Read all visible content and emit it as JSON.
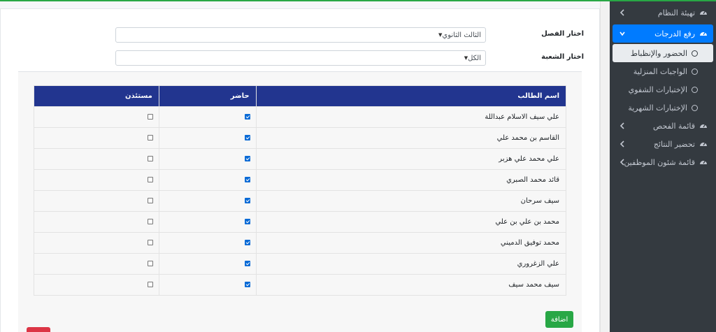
{
  "sidebar": {
    "items": [
      {
        "label": "تهيئة النظام",
        "icon": "gauge-icon",
        "chevron": "left"
      },
      {
        "label": "رفع الدرجات",
        "icon": "gauge-icon",
        "chevron": "down",
        "active": true
      },
      {
        "label": "قائمة الفحص",
        "icon": "gauge-icon",
        "chevron": "left"
      },
      {
        "label": "تحضير النتائج",
        "icon": "gauge-icon",
        "chevron": "left"
      },
      {
        "label": "قائمة شئون الموظفين",
        "icon": "gauge-icon",
        "chevron": "left"
      }
    ],
    "subitems": [
      {
        "label": "الحضور والإنظباط",
        "active": true
      },
      {
        "label": "الواجبات المنزلية"
      },
      {
        "label": "الإختبارات الشفوي"
      },
      {
        "label": "الإختبارات الشهرية"
      }
    ]
  },
  "form": {
    "class_label": "اختار الفصل",
    "class_value": "الثالث الثانوي",
    "section_label": "اختار الشعبة",
    "section_value": "الكل"
  },
  "table": {
    "headers": {
      "name": "اسم الطالب",
      "present": "حاضر",
      "excused": "مستئذن"
    },
    "rows": [
      {
        "name": "علي سيف الاسلام عبداللة",
        "present": true,
        "excused": false
      },
      {
        "name": "القاسم بن محمد علي",
        "present": true,
        "excused": false
      },
      {
        "name": "علي محمد علي هزبر",
        "present": true,
        "excused": false
      },
      {
        "name": "قائد محمد الصبري",
        "present": true,
        "excused": false
      },
      {
        "name": "سيف سرحان",
        "present": true,
        "excused": false
      },
      {
        "name": "محمد بن علي بن علي",
        "present": true,
        "excused": false
      },
      {
        "name": "محمد توفيق الدميني",
        "present": true,
        "excused": false
      },
      {
        "name": "علي الزغروري",
        "present": true,
        "excused": false
      },
      {
        "name": "سيف محمد سيف",
        "present": true,
        "excused": false
      }
    ]
  },
  "actions": {
    "add_label": "اضافة"
  },
  "colors": {
    "header": "#22358f",
    "active_nav": "#007bff",
    "sidebar": "#343a40",
    "add_button": "#28a745"
  }
}
